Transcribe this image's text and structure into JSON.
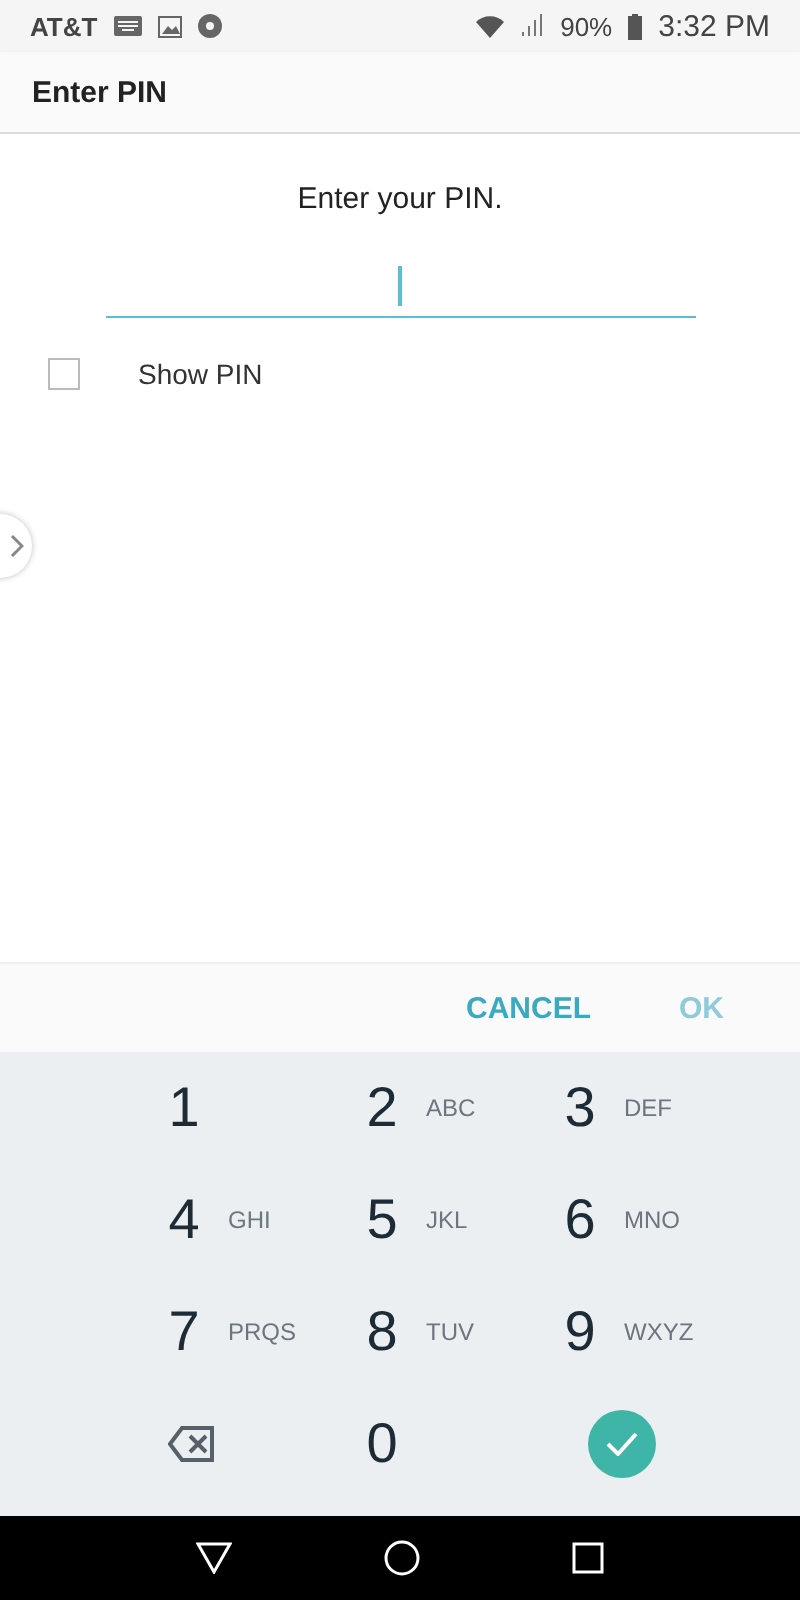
{
  "status_bar": {
    "carrier": "AT&T",
    "battery": "90%",
    "time": "3:32 PM"
  },
  "title": "Enter PIN",
  "prompt": "Enter your PIN.",
  "show_pin": {
    "label": "Show PIN",
    "checked": false
  },
  "actions": [
    {
      "label": "CANCEL",
      "disabled": false
    },
    {
      "label": "OK",
      "disabled": true
    }
  ],
  "keys": [
    {
      "kind": "digit",
      "digit": "1"
    },
    {
      "kind": "digit",
      "digit": "2",
      "letters": "ABC"
    },
    {
      "kind": "digit",
      "digit": "3",
      "letters": "DEF"
    },
    {
      "kind": "digit",
      "digit": "4",
      "letters": "GHI"
    },
    {
      "kind": "digit",
      "digit": "5",
      "letters": "JKL"
    },
    {
      "kind": "digit",
      "digit": "6",
      "letters": "MNO"
    },
    {
      "kind": "digit",
      "digit": "7",
      "letters": "PRQS"
    },
    {
      "kind": "digit",
      "digit": "8",
      "letters": "TUV"
    },
    {
      "kind": "digit",
      "digit": "9",
      "letters": "WXYZ"
    },
    {
      "kind": "backspace"
    },
    {
      "kind": "digit",
      "digit": "0"
    },
    {
      "kind": "done"
    }
  ]
}
